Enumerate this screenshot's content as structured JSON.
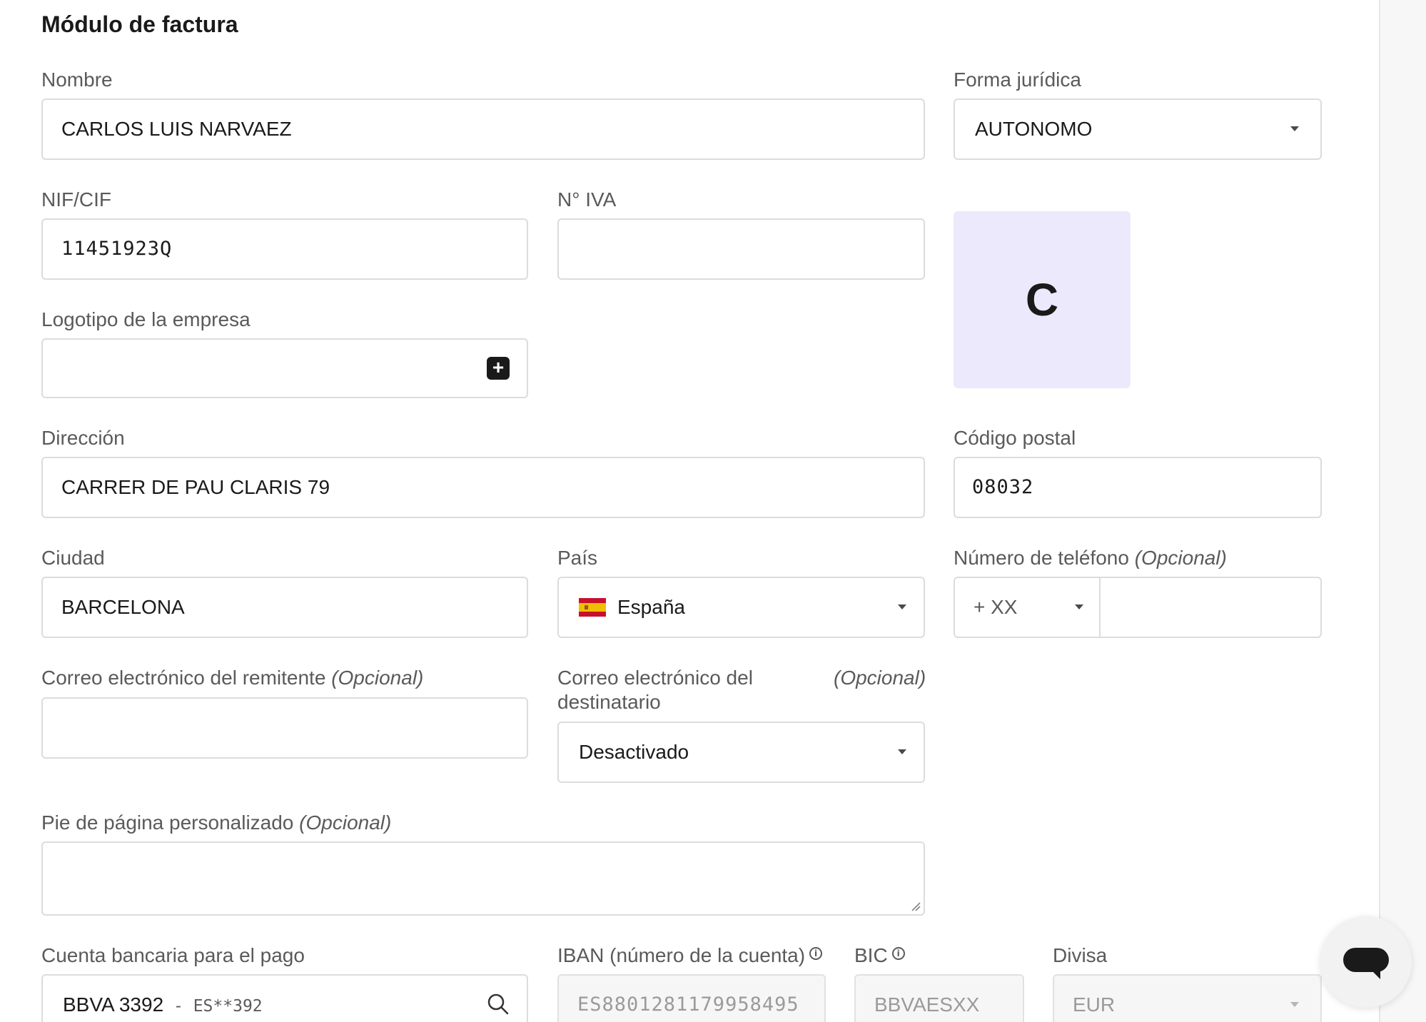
{
  "page": {
    "title": "Módulo de factura"
  },
  "form": {
    "nombre": {
      "label": "Nombre",
      "value": "CARLOS LUIS NARVAEZ"
    },
    "forma_juridica": {
      "label": "Forma jurídica",
      "value": "AUTONOMO"
    },
    "nif": {
      "label": "NIF/CIF",
      "value": "11451923Q"
    },
    "iva": {
      "label": "N° IVA",
      "value": ""
    },
    "logo": {
      "label": "Logotipo de la empresa",
      "preview_letter": "C",
      "add_symbol": "+"
    },
    "direccion": {
      "label": "Dirección",
      "value": "CARRER DE PAU CLARIS 79"
    },
    "codigo_postal": {
      "label": "Código postal",
      "value": "08032"
    },
    "ciudad": {
      "label": "Ciudad",
      "value": "BARCELONA"
    },
    "pais": {
      "label": "País",
      "value": "España",
      "flag": "spain-flag-icon"
    },
    "telefono": {
      "label": "Número de teléfono",
      "optional": "(Opcional)",
      "prefix": "+ XX",
      "value": ""
    },
    "correo_remitente": {
      "label": "Correo electrónico del remitente",
      "optional": "(Opcional)",
      "value": ""
    },
    "correo_destinatario": {
      "label_line1": "Correo electrónico del",
      "label_line2": "destinatario",
      "optional": "(Opcional)",
      "value": "Desactivado"
    },
    "pie_pagina": {
      "label": "Pie de página personalizado",
      "optional": "(Opcional)",
      "value": ""
    },
    "cuenta_bancaria": {
      "label": "Cuenta bancaria para el pago",
      "value_main": "BBVA 3392",
      "value_sep": " - ",
      "value_sub": "ES**392"
    },
    "iban": {
      "label": "IBAN (número de la cuenta)",
      "value": "ES8801281179958495"
    },
    "bic": {
      "label": "BIC",
      "value": "BBVAESXX"
    },
    "divisa": {
      "label": "Divisa",
      "value": "EUR"
    }
  },
  "colors": {
    "logo_bg": "#ece9fc",
    "border": "#dcdcdc",
    "text": "#1a1a1a",
    "label": "#5a5a5a"
  }
}
